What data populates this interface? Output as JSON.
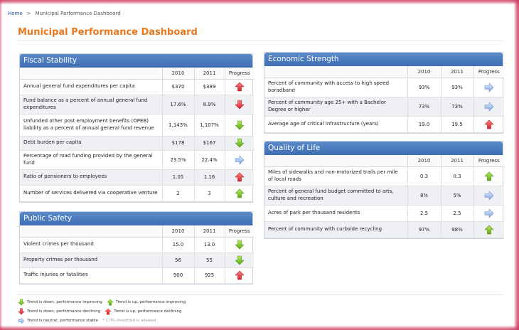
{
  "breadcrumb": {
    "home": "Home",
    "separator": ">",
    "current": "Municipal Performance Dashboard"
  },
  "page_title": "Municipal Performance Dashboard",
  "columns": {
    "year1": "2010",
    "year2": "2011",
    "progress": "Progress"
  },
  "fiscal": {
    "title": "Fiscal Stability",
    "rows": [
      {
        "label": "Annual general fund expenditures per capita",
        "y2010": "$370",
        "y2011": "$389",
        "trend": "up-bad"
      },
      {
        "label": "Fund balance as a percent of annual general fund expenditures",
        "y2010": "17.6%",
        "y2011": "8.9%",
        "trend": "down-bad"
      },
      {
        "label": "Unfunded other post employment benefits (OPEB) liability as a percent of annual general fund revenue",
        "y2010": "1,143%",
        "y2011": "1,107%",
        "trend": "down-good"
      },
      {
        "label": "Debt burden per capita",
        "y2010": "$178",
        "y2011": "$167",
        "trend": "down-good"
      },
      {
        "label": "Percentage of road funding provided by the general fund",
        "y2010": "23.5%",
        "y2011": "22.4%",
        "trend": "neutral"
      },
      {
        "label": "Ratio of pensioners to employees",
        "y2010": "1.05",
        "y2011": "1.16",
        "trend": "up-bad"
      },
      {
        "label": "Number of services delivered via cooperative venture",
        "y2010": "2",
        "y2011": "3",
        "trend": "up-good"
      }
    ]
  },
  "safety": {
    "title": "Public Safety",
    "rows": [
      {
        "label": "Violent crimes per thousand",
        "y2010": "15.0",
        "y2011": "13.0",
        "trend": "down-good"
      },
      {
        "label": "Property crimes per thousand",
        "y2010": "56",
        "y2011": "55",
        "trend": "down-good"
      },
      {
        "label": "Traffic injuries or fatalities",
        "y2010": "900",
        "y2011": "925",
        "trend": "up-bad"
      }
    ]
  },
  "economic": {
    "title": "Economic Strength",
    "rows": [
      {
        "label": "Percent of community with access to high speed boradband",
        "y2010": "93%",
        "y2011": "93%",
        "trend": "neutral"
      },
      {
        "label": "Percent of community age 25+ with a Bachelor Degree or higher",
        "y2010": "73%",
        "y2011": "73%",
        "trend": "neutral"
      },
      {
        "label": "Average age of critical infrastructure (years)",
        "y2010": "19.0",
        "y2011": "19.5",
        "trend": "up-bad"
      }
    ]
  },
  "quality": {
    "title": "Quality of Life",
    "rows": [
      {
        "label": "Miles of sidewalks and non-motorized trails per mile of local roads",
        "y2010": "0.3",
        "y2011": "0.3",
        "trend": "up-good"
      },
      {
        "label": "Percent of general fund budget committed to arts, culture and recreation",
        "y2010": "8%",
        "y2011": "5%",
        "trend": "neutral"
      },
      {
        "label": "Acres of park per thousand residents",
        "y2010": "2.5",
        "y2011": "2.5",
        "trend": "neutral"
      },
      {
        "label": "Percent of community with curbside recycling",
        "y2010": "97%",
        "y2011": "98%",
        "trend": "up-good"
      }
    ]
  },
  "legend": {
    "down_good": "Trend is down, performance improving",
    "up_good": "Trend is up, performance improving",
    "down_bad": "Trend is down, performance declining",
    "up_bad": "Trend is up, performance declining",
    "neutral": "Trend is neutral, performance stable",
    "note": "* 1.0% threshold is allowed"
  },
  "colors": {
    "good": "#7cc21e",
    "bad": "#e0303a",
    "neutral": "#8fb3ea",
    "title": "#e8781e",
    "panel_header": "#4a7bbd"
  }
}
